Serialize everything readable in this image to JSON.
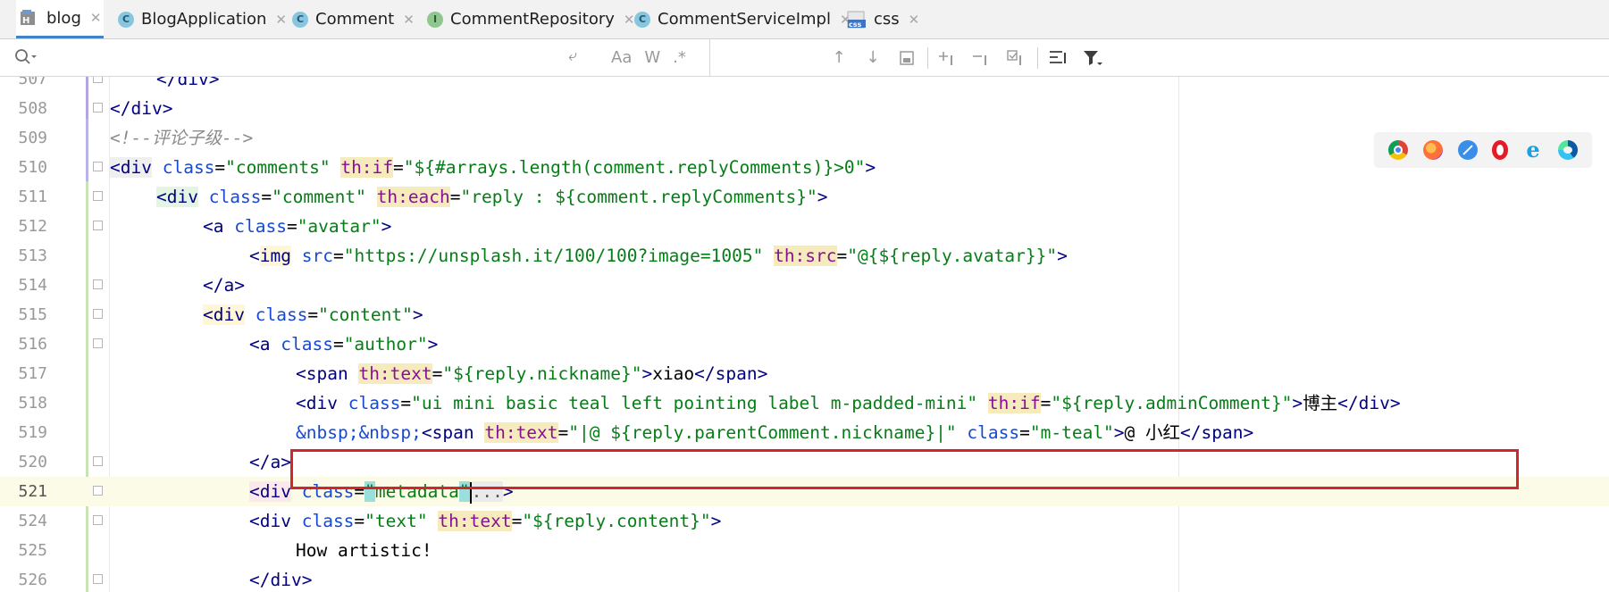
{
  "tabs": [
    {
      "label": "blog",
      "icon": "module-icon",
      "active": true
    },
    {
      "label": "BlogApplication",
      "icon": "run-class-icon"
    },
    {
      "label": "Comment",
      "icon": "class-icon"
    },
    {
      "label": "CommentRepository",
      "icon": "interface-icon"
    },
    {
      "label": "CommentServiceImpl",
      "icon": "class-icon"
    },
    {
      "label": "css",
      "icon": "css-file-icon"
    }
  ],
  "search": {
    "placeholder": "",
    "options": {
      "match_case": "Aa",
      "words": "W",
      "regex": ".*"
    }
  },
  "browsers": [
    "chrome-icon",
    "firefox-icon",
    "safari-icon",
    "opera-icon",
    "ie-icon",
    "edge-icon"
  ],
  "lines": [
    {
      "num": "507",
      "text": "</div>"
    },
    {
      "num": "508",
      "text": "</div>"
    },
    {
      "num": "509",
      "text": "<!--评论子级-->"
    },
    {
      "num": "510",
      "text": "<div class=\"comments\" th:if=\"${#arrays.length(comment.replyComments)}>0\">"
    },
    {
      "num": "511",
      "text": "<div class=\"comment\" th:each=\"reply : ${comment.replyComments}\">"
    },
    {
      "num": "512",
      "text": "<a class=\"avatar\">"
    },
    {
      "num": "513",
      "text": "<img src=\"https://unsplash.it/100/100?image=1005\" th:src=\"@{${reply.avatar}}\">"
    },
    {
      "num": "514",
      "text": "</a>"
    },
    {
      "num": "515",
      "text": "<div class=\"content\">"
    },
    {
      "num": "516",
      "text": "<a class=\"author\">"
    },
    {
      "num": "517",
      "text": "<span th:text=\"${reply.nickname}\">xiao</span>"
    },
    {
      "num": "518",
      "text": "<div class=\"ui mini basic teal left pointing label m-padded-mini\" th:if=\"${reply.adminComment}\">博主</div>"
    },
    {
      "num": "519",
      "text": "&nbsp;&nbsp;<span th:text=\"|@ ${reply.parentComment.nickname}|\" class=\"m-teal\">@ 小红</span>"
    },
    {
      "num": "520",
      "text": "</a>"
    },
    {
      "num": "521",
      "text": "<div class=\"metadata\"...>"
    },
    {
      "num": "524",
      "text": "<div class=\"text\" th:text=\"${reply.content}\">"
    },
    {
      "num": "525",
      "text": "How artistic!"
    },
    {
      "num": "526",
      "text": "</div>"
    }
  ],
  "colors": {
    "highlight_box": "#d2262d",
    "active_tab_underline": "#4083c9",
    "tag": "#000080",
    "attribute": "#174ad4",
    "value": "#067d17",
    "thymeleaf_attr_bg": "#f6ebbc"
  }
}
